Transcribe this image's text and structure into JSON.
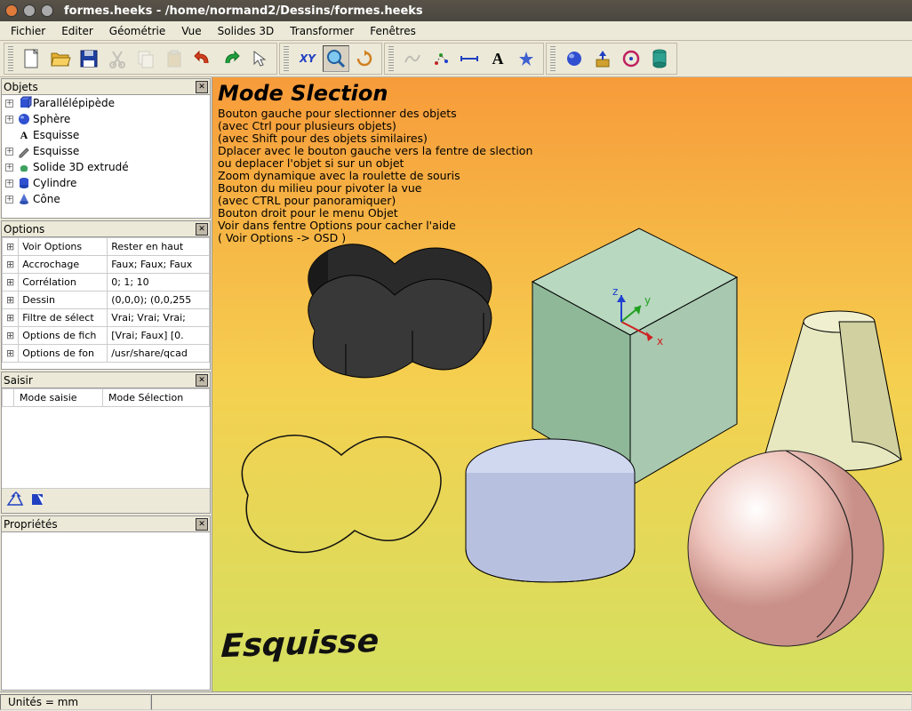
{
  "window": {
    "title": "formes.heeks - /home/normand2/Dessins/formes.heeks"
  },
  "menu": [
    "Fichier",
    "Editer",
    "Géométrie",
    "Vue",
    "Solides 3D",
    "Transformer",
    "Fenêtres"
  ],
  "panels": {
    "objets": {
      "title": "Objets"
    },
    "options": {
      "title": "Options"
    },
    "saisir": {
      "title": "Saisir"
    },
    "proprietes": {
      "title": "Propriétés"
    }
  },
  "tree": [
    {
      "label": "Parallélépipède",
      "icon": "cube-blue"
    },
    {
      "label": "Sphère",
      "icon": "sphere-blue"
    },
    {
      "label": "Esquisse",
      "icon": "text-a"
    },
    {
      "label": "Esquisse",
      "icon": "pencil"
    },
    {
      "label": "Solide 3D extrudé",
      "icon": "blob-green"
    },
    {
      "label": "Cylindre",
      "icon": "cylinder-blue"
    },
    {
      "label": "Cône",
      "icon": "cone-blue"
    }
  ],
  "options_rows": [
    {
      "k": "Voir Options",
      "v": "Rester en haut"
    },
    {
      "k": "Accrochage",
      "v": "Faux; Faux; Faux"
    },
    {
      "k": "Corrélation",
      "v": "0; 1; 10"
    },
    {
      "k": "Dessin",
      "v": "(0,0,0); (0,0,255"
    },
    {
      "k": "Filtre de sélect",
      "v": "Vrai; Vrai; Vrai;"
    },
    {
      "k": "Options de fich",
      "v": "[Vrai; Faux] [0."
    },
    {
      "k": "Options de fon",
      "v": "/usr/share/qcad"
    }
  ],
  "saisir_row": {
    "k": "Mode saisie",
    "v": "Mode Sélection"
  },
  "osd": {
    "title": "Mode Slection",
    "lines": [
      "Bouton gauche pour slectionner des objets",
      "(avec Ctrl pour plusieurs objets)",
      "(avec Shift pour des objets similaires)",
      "Dplacer avec le bouton gauche vers la fentre de slection",
      "ou deplacer l'objet si sur un objet",
      "Zoom dynamique avec la roulette de souris",
      "Bouton du milieu pour pivoter la vue",
      "(avec CTRL pour panoramiquer)",
      "Bouton droit pour le menu Objet",
      "Voir dans fentre Options pour cacher l'aide",
      "( Voir Options -> OSD )"
    ]
  },
  "viewport_label": "Esquisse",
  "status": {
    "units": "Unités = mm"
  }
}
